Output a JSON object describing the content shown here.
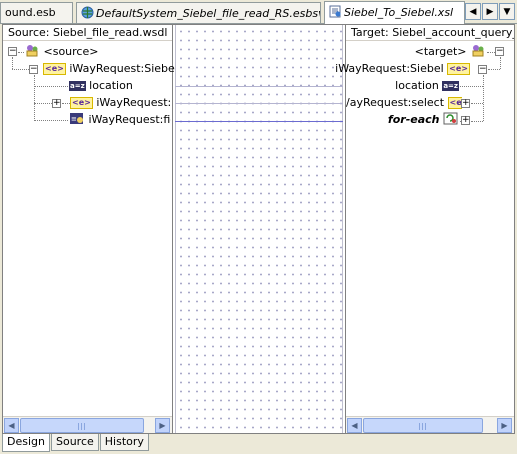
{
  "tabs": [
    {
      "label": "ound.esb",
      "italic": false,
      "active": false
    },
    {
      "label": "DefaultSystem_Siebel_file_read_RS.esbsvc",
      "italic": true,
      "active": false
    },
    {
      "label": "Siebel_To_Siebel.xsl",
      "italic": true,
      "active": true
    }
  ],
  "source": {
    "header": "Source: Siebel_file_read.wsdl",
    "root": "<source>",
    "element": "iWayRequest:Siebel",
    "children": [
      "location",
      "iWayRequest:sele",
      "iWayRequest:fiel"
    ]
  },
  "target": {
    "header": "Target: Siebel_account_query_inv",
    "root": "<target>",
    "element": "iWayRequest:Siebel",
    "children": [
      "location",
      "/ayRequest:select",
      "for-each"
    ]
  },
  "bottom_tabs": [
    "Design",
    "Source",
    "History"
  ],
  "icons": {
    "esb": "esb-file-icon",
    "esbsvc": "globe-icon",
    "xsl": "xsl-file-icon"
  }
}
